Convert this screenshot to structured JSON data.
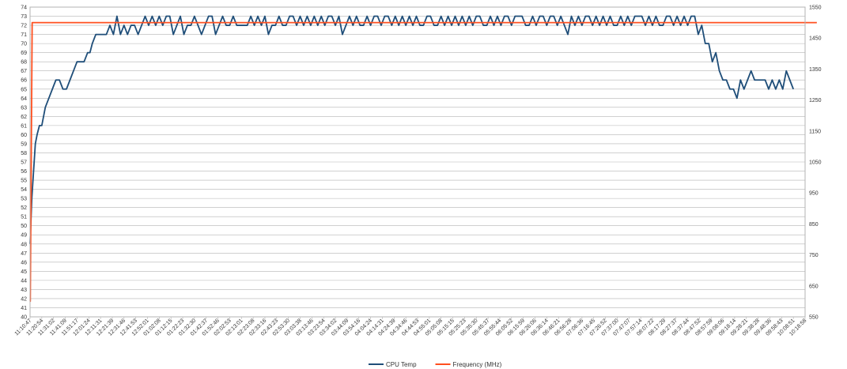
{
  "chart_data": {
    "type": "line",
    "title": "",
    "xlabel": "",
    "ylabel": "",
    "ylabel_right": "",
    "grid": true,
    "legend_placement": "bottom",
    "x_ticks": [
      "11:10:47",
      "11:20:54",
      "11:31:02",
      "11:41:09",
      "11:51:17",
      "12:01:24",
      "12:11:31",
      "12:21:39",
      "12:31:46",
      "12:41:53",
      "12:52:01",
      "01:02:08",
      "01:12:15",
      "01:22:23",
      "01:32:30",
      "01:42:37",
      "01:52:46",
      "02:02:53",
      "02:13:01",
      "02:23:08",
      "02:33:16",
      "02:43:23",
      "02:53:30",
      "03:03:38",
      "03:13:46",
      "03:23:54",
      "03:34:02",
      "03:44:09",
      "03:54:16",
      "04:04:24",
      "04:14:31",
      "04:24:39",
      "04:34:46",
      "04:44:53",
      "04:55:01",
      "05:05:08",
      "05:15:15",
      "05:25:23",
      "05:35:30",
      "05:45:37",
      "05:55:44",
      "06:05:52",
      "06:15:59",
      "06:26:06",
      "06:36:14",
      "06:46:21",
      "06:56:28",
      "07:06:36",
      "07:16:45",
      "07:26:52",
      "07:37:00",
      "07:47:07",
      "07:57:14",
      "08:07:22",
      "08:17:29",
      "08:27:37",
      "08:37:44",
      "08:47:52",
      "08:57:59",
      "09:08:06",
      "09:18:14",
      "09:28:21",
      "09:38:28",
      "09:48:36",
      "09:58:43",
      "10:08:51",
      "10:18:58"
    ],
    "y_left": {
      "min": 40,
      "max": 74,
      "step": 1
    },
    "y_right": {
      "min": 550,
      "max": 1550,
      "step": 100
    },
    "series": [
      {
        "name": "CPU Temp",
        "axis": "left",
        "color": "#1f4e79",
        "x_index": [
          0,
          0.15,
          0.3,
          0.45,
          0.6,
          0.8,
          1,
          1.3,
          1.6,
          1.9,
          2.2,
          2.5,
          2.8,
          3.1,
          3.4,
          3.7,
          4,
          4.3,
          4.6,
          4.9,
          5.1,
          5.3,
          5.6,
          5.9,
          6.2,
          6.5,
          6.8,
          7.1,
          7.4,
          7.7,
          8,
          8.3,
          8.6,
          8.9,
          9.2,
          9.5,
          9.8,
          10.1,
          10.4,
          10.7,
          11,
          11.3,
          11.6,
          11.9,
          12.2,
          12.5,
          12.8,
          13.1,
          13.4,
          13.7,
          14,
          14.3,
          14.6,
          14.9,
          15.2,
          15.5,
          15.8,
          16.1,
          16.4,
          16.7,
          17,
          17.3,
          17.6,
          17.9,
          18.2,
          18.5,
          18.8,
          19.1,
          19.4,
          19.7,
          20,
          20.3,
          20.6,
          20.9,
          21.2,
          21.5,
          21.8,
          22.1,
          22.4,
          22.7,
          23,
          23.3,
          23.6,
          23.9,
          24.2,
          24.5,
          24.8,
          25.1,
          25.4,
          25.7,
          26,
          26.3,
          26.6,
          26.9,
          27.2,
          27.5,
          27.8,
          28.1,
          28.4,
          28.7,
          29,
          29.3,
          29.6,
          29.9,
          30.2,
          30.5,
          30.8,
          31.1,
          31.4,
          31.7,
          32,
          32.3,
          32.6,
          32.9,
          33.2,
          33.5,
          33.8,
          34.1,
          34.4,
          34.7,
          35,
          35.3,
          35.6,
          35.9,
          36.2,
          36.5,
          36.8,
          37.1,
          37.4,
          37.7,
          38,
          38.3,
          38.6,
          38.9,
          39.2,
          39.5,
          39.8,
          40.1,
          40.4,
          40.7,
          41,
          41.3,
          41.6,
          41.9,
          42.2,
          42.5,
          42.8,
          43.1,
          43.4,
          43.7,
          44,
          44.3,
          44.6,
          44.9,
          45.2,
          45.5,
          45.8,
          46.1,
          46.4,
          46.7,
          47,
          47.3,
          47.6,
          47.9,
          48.2,
          48.5,
          48.8,
          49.1,
          49.4,
          49.7,
          50,
          50.3,
          50.6,
          50.9,
          51.2,
          51.5,
          51.8,
          52.1,
          52.4,
          52.7,
          53,
          53.3,
          53.6,
          53.9,
          54.2,
          54.5,
          54.8,
          55.1,
          55.4,
          55.7,
          56,
          56.3,
          56.6,
          56.9,
          57.2,
          57.5,
          57.8,
          58.1,
          58.4,
          58.7,
          59,
          59.3,
          59.6,
          59.9,
          60.2,
          60.5,
          60.8,
          61.1,
          61.4,
          61.7,
          62,
          62.3,
          62.6,
          62.9,
          63.2,
          63.5,
          63.8,
          64.1,
          64.4,
          64.7,
          65,
          65.3,
          65.6,
          65.9,
          66.2,
          66.5,
          66.8,
          67
        ],
        "values": [
          48,
          53,
          56,
          59,
          60,
          61,
          61,
          63,
          64,
          65,
          66,
          66,
          65,
          65,
          66,
          67,
          68,
          68,
          68,
          69,
          69,
          70,
          71,
          71,
          71,
          71,
          72,
          71,
          73,
          71,
          72,
          71,
          72,
          72,
          71,
          72,
          73,
          72,
          73,
          72,
          73,
          72,
          73,
          73,
          71,
          72,
          73,
          71,
          72,
          72,
          73,
          72,
          71,
          72,
          73,
          73,
          71,
          72,
          73,
          72,
          72,
          73,
          72,
          72,
          72,
          72,
          73,
          72,
          73,
          72,
          73,
          71,
          72,
          72,
          73,
          72,
          72,
          73,
          73,
          72,
          73,
          72,
          73,
          72,
          73,
          72,
          73,
          72,
          73,
          73,
          72,
          73,
          71,
          72,
          73,
          72,
          73,
          72,
          72,
          73,
          72,
          73,
          73,
          72,
          73,
          73,
          72,
          73,
          72,
          73,
          72,
          73,
          72,
          73,
          72,
          72,
          73,
          73,
          72,
          72,
          73,
          72,
          73,
          72,
          73,
          72,
          73,
          72,
          73,
          72,
          73,
          73,
          72,
          72,
          73,
          72,
          73,
          72,
          73,
          73,
          72,
          73,
          73,
          73,
          72,
          72,
          73,
          72,
          73,
          73,
          72,
          73,
          73,
          72,
          73,
          72,
          71,
          73,
          72,
          73,
          72,
          73,
          73,
          72,
          73,
          72,
          73,
          72,
          73,
          72,
          72,
          73,
          72,
          73,
          72,
          73,
          73,
          73,
          72,
          73,
          72,
          73,
          72,
          72,
          73,
          73,
          72,
          73,
          72,
          73,
          72,
          73,
          73,
          71,
          72,
          70,
          70,
          68,
          69,
          67,
          66,
          66,
          65,
          65,
          64,
          66,
          65,
          66,
          67,
          66,
          66,
          66,
          66,
          65,
          66,
          65,
          66,
          65,
          67,
          66,
          65
        ],
        "values_note": ""
      },
      {
        "name": "Frequency (MHz)",
        "axis": "right",
        "color": "#ff4f1f",
        "x_index": [
          0,
          0.02,
          0.18,
          67
        ],
        "values": [
          600,
          600,
          1500,
          1500
        ]
      }
    ]
  }
}
